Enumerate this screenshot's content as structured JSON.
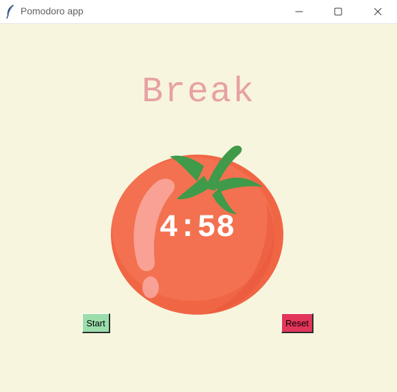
{
  "window": {
    "title": "Pomodoro app",
    "minimize_icon": "minimize-icon",
    "maximize_icon": "maximize-icon",
    "close_icon": "close-icon"
  },
  "app": {
    "heading": "Break",
    "timer": "4:58",
    "start_label": "Start",
    "reset_label": "Reset"
  },
  "colors": {
    "background": "#f8f5de",
    "heading": "#e7a2a2",
    "start_button": "#9bdeac",
    "reset_button": "#e2355a",
    "tomato": "#f26b4c"
  }
}
